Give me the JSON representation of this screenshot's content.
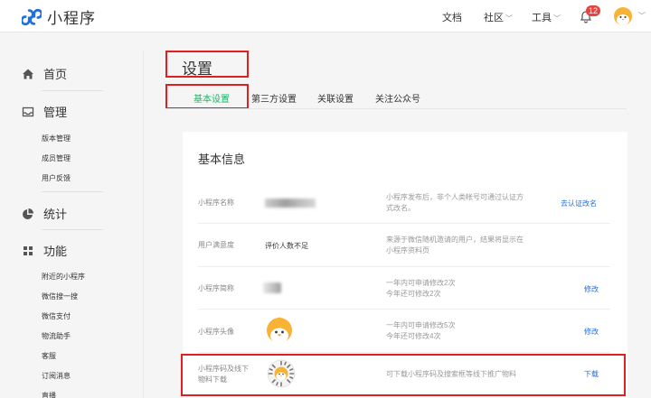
{
  "app": {
    "name": "小程序"
  },
  "topnav": {
    "docs": "文档",
    "community": "社区",
    "tools": "工具",
    "notification_count": "12"
  },
  "sidebar": {
    "home": "首页",
    "manage": {
      "label": "管理",
      "items": [
        "版本管理",
        "成员管理",
        "用户反馈"
      ]
    },
    "stats": "统计",
    "features": {
      "label": "功能",
      "items": [
        "附近的小程序",
        "微信搜一搜",
        "微信支付",
        "物流助手",
        "客服",
        "订阅消息",
        "直播"
      ]
    }
  },
  "page": {
    "title": "设置",
    "tabs": [
      {
        "label": "基本设置",
        "active": true
      },
      {
        "label": "第三方设置",
        "active": false
      },
      {
        "label": "关联设置",
        "active": false
      },
      {
        "label": "关注公众号",
        "active": false
      }
    ]
  },
  "basic_info": {
    "title": "基本信息",
    "rows": [
      {
        "label": "小程序名称",
        "value": "",
        "desc": [
          "小程序发布后，非个人类帐号可通过认证方",
          "式改名。"
        ],
        "link": "去认证改名"
      },
      {
        "label": "用户满意度",
        "value": "评价人数不足",
        "desc": [
          "来源于微信随机邀请的用户，结果将显示在",
          "小程序资料页"
        ],
        "link": ""
      },
      {
        "label": "小程序简称",
        "value": "",
        "desc": [
          "一年内可申请修改2次",
          "今年还可修改2次"
        ],
        "link": "修改"
      },
      {
        "label": "小程序头像",
        "value": "",
        "desc": [
          "一年内可申请修改5次",
          "今年还可修改4次"
        ],
        "link": "修改"
      },
      {
        "label": [
          "小程序码及线下",
          "物料下载"
        ],
        "value": "",
        "desc": [
          "可下载小程序码及搜索框等线下推广物料"
        ],
        "link": "下载"
      }
    ]
  },
  "colors": {
    "accent": "#07c160",
    "link": "#1e6fe3",
    "highlight": "#e02020",
    "badge": "#e64340"
  }
}
